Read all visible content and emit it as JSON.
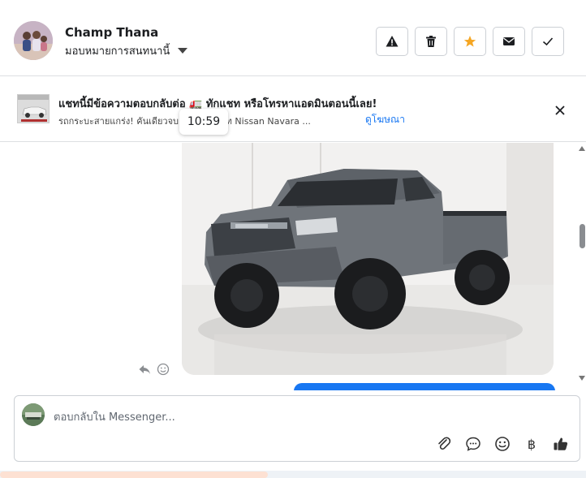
{
  "header": {
    "contact_name": "Champ Thana",
    "assign_label": "มอบหมายการสนทนานี้",
    "actions": [
      {
        "name": "report-spam-button",
        "icon": "warning-icon"
      },
      {
        "name": "delete-button",
        "icon": "trash-icon"
      },
      {
        "name": "star-button",
        "icon": "star-icon",
        "color": "#f5a623"
      },
      {
        "name": "mark-unread-button",
        "icon": "envelope-icon"
      },
      {
        "name": "mark-done-button",
        "icon": "check-icon"
      }
    ]
  },
  "ad_banner": {
    "title": "แชทนี้มีข้อความตอบกลับต่อ 🚛 ทักแชท หรือโทรหาแอดมินตอนนี้เลย!",
    "subtitle": "รถกระบะสายแกร่ง! คันเดียวจบ 40,000 บาท Nissan Navara ...",
    "link": "ดูโฆษณา",
    "close_icon": "close-icon"
  },
  "tooltip": {
    "time": "10:59"
  },
  "message": {
    "image_subject": "grey-pickup-truck-photo",
    "actions": [
      "reply-icon",
      "react-icon"
    ]
  },
  "composer": {
    "placeholder": "ตอบกลับใน Messenger...",
    "tools": [
      {
        "name": "attach-button",
        "icon": "paperclip-icon"
      },
      {
        "name": "saved-replies-button",
        "icon": "chat-bubble-icon"
      },
      {
        "name": "emoji-button",
        "icon": "smile-icon"
      },
      {
        "name": "payment-button",
        "icon": "baht-icon",
        "glyph": "฿"
      },
      {
        "name": "like-button",
        "icon": "thumbs-up-icon"
      }
    ]
  },
  "colors": {
    "accent": "#1877f2",
    "star": "#f5a623"
  }
}
